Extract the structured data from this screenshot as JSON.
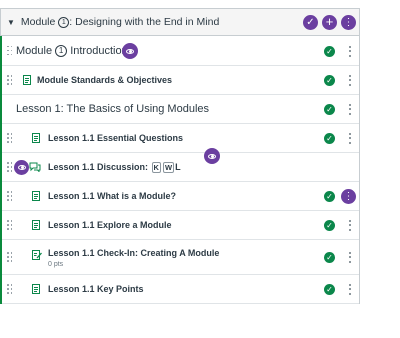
{
  "module": {
    "title_prefix": "Module ",
    "number": "1",
    "title_suffix": ": Designing with the End in Mind"
  },
  "items": [
    {
      "type": "header",
      "prefix": "Module ",
      "number": "1",
      "suffix": " Introduction"
    },
    {
      "type": "page",
      "title": "Module Standards & Objectives"
    },
    {
      "type": "header",
      "title": "Lesson 1: The Basics of Using Modules"
    },
    {
      "type": "page",
      "title": "Lesson 1.1 Essential Questions"
    },
    {
      "type": "discussion",
      "title": "Lesson 1.1 Discussion: ",
      "k1": "K",
      "k2": "W",
      "k3": "L"
    },
    {
      "type": "page",
      "title": "Lesson 1.1 What is a Module?"
    },
    {
      "type": "page",
      "title": "Lesson 1.1 Explore a Module"
    },
    {
      "type": "assignment",
      "title": "Lesson 1.1 Check-In: Creating A Module",
      "points": "0 pts"
    },
    {
      "type": "page",
      "title": "Lesson 1.1 Key Points"
    }
  ],
  "icons": {
    "header_buttons": [
      "check-icon",
      "plus-icon",
      "kebab-icon"
    ],
    "accent": "#6b3fa0",
    "published": "#0b874b"
  }
}
